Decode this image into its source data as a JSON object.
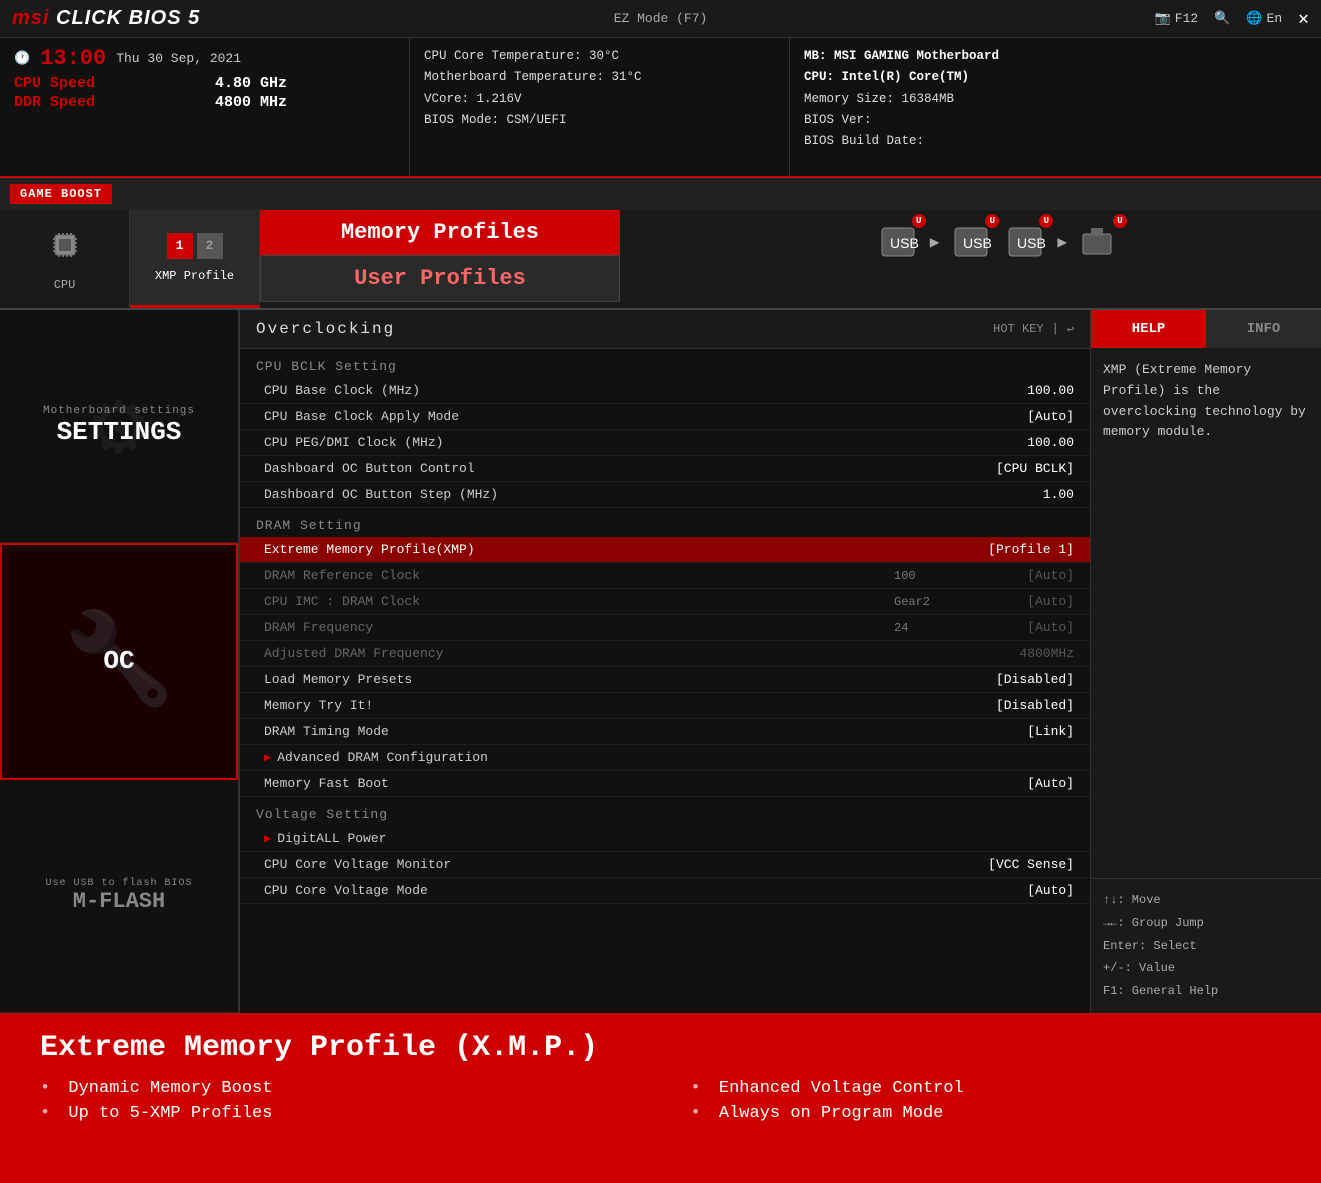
{
  "topbar": {
    "logo_msi": "msi",
    "logo_bios": "CLICK BIOS 5",
    "ez_mode": "EZ Mode (F7)",
    "f12": "F12",
    "lang": "En",
    "close": "✕"
  },
  "header": {
    "time": "13:00",
    "date": "Thu 30 Sep, 2021",
    "cpu_speed_label": "CPU Speed",
    "cpu_speed_value": "4.80 GHz",
    "ddr_speed_label": "DDR Speed",
    "ddr_speed_value": "4800 MHz",
    "cpu_temp": "CPU Core Temperature: 30°C",
    "mb_temp": "Motherboard Temperature: 31°C",
    "vcore": "VCore: 1.216V",
    "bios_mode": "BIOS Mode: CSM/UEFI",
    "mb": "MB:  MSI GAMING Motherboard",
    "cpu": "CPU: Intel(R) Core(TM)",
    "memory_size": "Memory Size: 16384MB",
    "bios_ver": "BIOS Ver:",
    "bios_build": "BIOS Build Date:"
  },
  "game_boost": "GAME BOOST",
  "nav": {
    "cpu_label": "CPU",
    "xmp_label": "XMP Profile",
    "xmp_num1": "1",
    "xmp_num2": "2",
    "mem_profiles": "Memory Profiles",
    "user_profiles": "User Profiles"
  },
  "sidebar": {
    "settings_sub": "Motherboard settings",
    "settings_title": "SETTINGS",
    "oc_title": "OC",
    "mflash_sub": "Use USB to flash BIOS",
    "mflash_title": "M-FLASH"
  },
  "overclocking": {
    "title": "Overclocking",
    "hotkey": "HOT KEY",
    "sections": {
      "cpu_bclk": "CPU BCLK  Setting",
      "dram": "DRAM  Setting",
      "voltage": "Voltage  Setting"
    },
    "rows": [
      {
        "name": "CPU Base Clock (MHz)",
        "mid": "",
        "val": "100.00",
        "dim": false,
        "highlighted": false,
        "arrow": false
      },
      {
        "name": "CPU Base Clock Apply Mode",
        "mid": "",
        "val": "[Auto]",
        "dim": false,
        "highlighted": false,
        "arrow": false
      },
      {
        "name": "CPU PEG/DMI Clock (MHz)",
        "mid": "",
        "val": "100.00",
        "dim": false,
        "highlighted": false,
        "arrow": false
      },
      {
        "name": "Dashboard OC Button Control",
        "mid": "",
        "val": "[CPU BCLK]",
        "dim": false,
        "highlighted": false,
        "arrow": false
      },
      {
        "name": "Dashboard OC Button Step (MHz)",
        "mid": "",
        "val": "1.00",
        "dim": false,
        "highlighted": false,
        "arrow": false
      },
      {
        "name": "Extreme Memory Profile(XMP)",
        "mid": "",
        "val": "[Profile 1]",
        "dim": false,
        "highlighted": true,
        "arrow": false
      },
      {
        "name": "DRAM Reference Clock",
        "mid": "100",
        "val": "[Auto]",
        "dim": true,
        "highlighted": false,
        "arrow": false
      },
      {
        "name": "CPU IMC : DRAM Clock",
        "mid": "Gear2",
        "val": "[Auto]",
        "dim": true,
        "highlighted": false,
        "arrow": false
      },
      {
        "name": "DRAM Frequency",
        "mid": "24",
        "val": "[Auto]",
        "dim": true,
        "highlighted": false,
        "arrow": false
      },
      {
        "name": "Adjusted DRAM Frequency",
        "mid": "",
        "val": "4800MHz",
        "dim": true,
        "highlighted": false,
        "arrow": false
      },
      {
        "name": "Load Memory Presets",
        "mid": "",
        "val": "[Disabled]",
        "dim": false,
        "highlighted": false,
        "arrow": false
      },
      {
        "name": "Memory Try It!",
        "mid": "",
        "val": "[Disabled]",
        "dim": false,
        "highlighted": false,
        "arrow": false
      },
      {
        "name": "DRAM Timing Mode",
        "mid": "",
        "val": "[Link]",
        "dim": false,
        "highlighted": false,
        "arrow": false
      },
      {
        "name": "Advanced DRAM Configuration",
        "mid": "",
        "val": "",
        "dim": false,
        "highlighted": false,
        "arrow": true
      },
      {
        "name": "Memory Fast Boot",
        "mid": "",
        "val": "[Auto]",
        "dim": false,
        "highlighted": false,
        "arrow": false
      },
      {
        "name": "DigitALL Power",
        "mid": "",
        "val": "",
        "dim": false,
        "highlighted": false,
        "arrow": true
      },
      {
        "name": "CPU Core Voltage Monitor",
        "mid": "",
        "val": "[VCC Sense]",
        "dim": false,
        "highlighted": false,
        "arrow": false
      },
      {
        "name": "CPU Core Voltage Mode",
        "mid": "",
        "val": "[Auto]",
        "dim": false,
        "highlighted": false,
        "arrow": false
      }
    ]
  },
  "help": {
    "help_label": "HELP",
    "info_label": "INFO",
    "content": "XMP (Extreme Memory Profile) is the overclocking technology by memory module.",
    "keys": [
      "↑↓: Move",
      "→←: Group Jump",
      "Enter: Select",
      "+/-: Value",
      "F1: General Help"
    ]
  },
  "bottom": {
    "title": "Extreme Memory Profile (X.M.P.)",
    "features": [
      "Dynamic Memory Boost",
      "Enhanced Voltage Control",
      "Up to 5-XMP Profiles",
      "Always on Program Mode"
    ]
  }
}
